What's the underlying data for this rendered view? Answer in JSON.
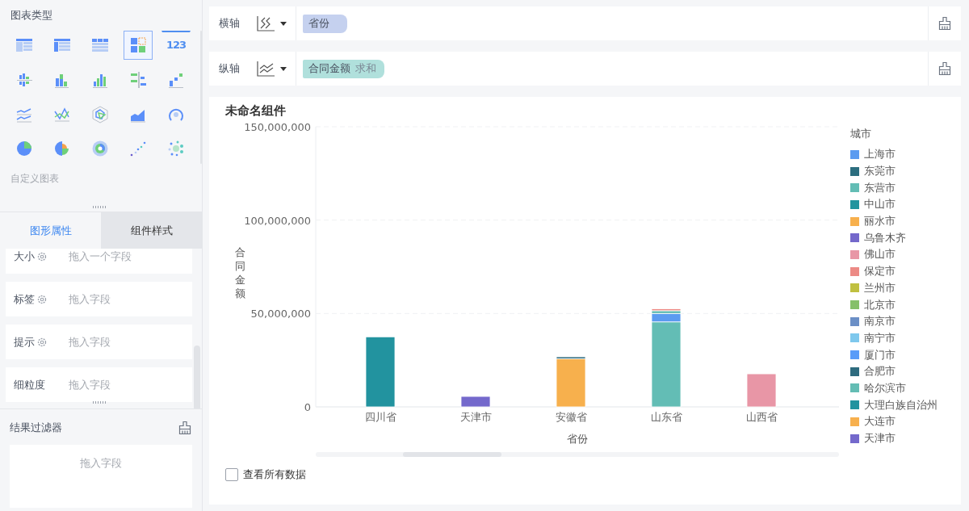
{
  "chart_types": {
    "title": "图表类型",
    "items": [
      {
        "kind": "table",
        "selected": false
      },
      {
        "kind": "cross-table",
        "selected": false
      },
      {
        "kind": "detail-table",
        "selected": false
      },
      {
        "kind": "matrix",
        "selected": true
      },
      {
        "kind": "number",
        "selected": false,
        "text": "123"
      },
      {
        "kind": "diverging-bar",
        "selected": false
      },
      {
        "kind": "stacked-bar",
        "selected": false
      },
      {
        "kind": "grouped-bar",
        "selected": false
      },
      {
        "kind": "horizontal-bar",
        "selected": false
      },
      {
        "kind": "waterfall",
        "selected": false
      },
      {
        "kind": "line",
        "selected": false
      },
      {
        "kind": "cross-line",
        "selected": false
      },
      {
        "kind": "radar",
        "selected": false
      },
      {
        "kind": "area",
        "selected": false
      },
      {
        "kind": "gauge",
        "selected": false
      },
      {
        "kind": "pie",
        "selected": false
      },
      {
        "kind": "rose",
        "selected": false
      },
      {
        "kind": "sunburst",
        "selected": false
      },
      {
        "kind": "scatter",
        "selected": false
      },
      {
        "kind": "bubble",
        "selected": false
      }
    ],
    "custom_label": "自定义图表"
  },
  "tabs": [
    {
      "label": "图形属性",
      "selected": true
    },
    {
      "label": "组件样式",
      "selected": false
    }
  ],
  "fields": [
    {
      "label": "大小",
      "settings": true,
      "placeholder": "拖入一个字段"
    },
    {
      "label": "标签",
      "settings": true,
      "placeholder": "拖入字段"
    },
    {
      "label": "提示",
      "settings": true,
      "placeholder": "拖入字段"
    },
    {
      "label": "细粒度",
      "settings": false,
      "placeholder": "拖入字段"
    }
  ],
  "result_filter": {
    "title": "结果过滤器",
    "placeholder": "拖入字段"
  },
  "shelves": [
    {
      "label": "横轴",
      "kind": "category",
      "pill": "省份",
      "color": "#c5d1ef"
    },
    {
      "label": "纵轴",
      "kind": "value",
      "pill": "合同金额",
      "pill_note": "求和",
      "color": "#b0e0dc"
    }
  ],
  "card": {
    "title": "未命名组件",
    "show_all": {
      "label": "查看所有数据",
      "checked": false
    },
    "chart_data": {
      "type": "bar",
      "stacked": true,
      "xlabel": "省份",
      "ylabel": "合同金额",
      "legend_title": "城市",
      "categories": [
        "四川省",
        "天津市",
        "安徽省",
        "山东省",
        "山西省"
      ],
      "ylim": [
        0,
        150000000
      ],
      "yticks": [
        {
          "value": 0,
          "label": "0"
        },
        {
          "value": 50000000,
          "label": "50,000,000"
        },
        {
          "value": 100000000,
          "label": "100,000,000"
        },
        {
          "value": 150000000,
          "label": "150,000,000"
        }
      ],
      "series": [
        {
          "name": "上海市",
          "color": "#5b9bf0",
          "values": [
            null,
            null,
            null,
            4500000,
            null
          ]
        },
        {
          "name": "东莞市",
          "color": "#2c6e7f",
          "values": [
            null,
            null,
            null,
            null,
            null
          ]
        },
        {
          "name": "东营市",
          "color": "#63bdb5",
          "values": [
            null,
            null,
            null,
            45500000,
            null
          ]
        },
        {
          "name": "中山市",
          "color": "#21949e",
          "values": [
            null,
            null,
            null,
            null,
            null
          ]
        },
        {
          "name": "丽水市",
          "color": "#f7b04d",
          "values": [
            null,
            null,
            25800000,
            null,
            null
          ]
        },
        {
          "name": "乌鲁木齐",
          "color": "#7468cb",
          "values": [
            null,
            null,
            null,
            null,
            null
          ]
        },
        {
          "name": "佛山市",
          "color": "#e896a6",
          "values": [
            null,
            null,
            null,
            null,
            17700000
          ]
        },
        {
          "name": "保定市",
          "color": "#ec8a85",
          "values": [
            null,
            null,
            null,
            1000000,
            null
          ]
        },
        {
          "name": "兰州市",
          "color": "#c0c040",
          "values": [
            null,
            null,
            null,
            null,
            null
          ]
        },
        {
          "name": "北京市",
          "color": "#86c06a",
          "values": [
            null,
            null,
            null,
            null,
            null
          ]
        },
        {
          "name": "南京市",
          "color": "#6b8fc6",
          "values": [
            null,
            null,
            null,
            null,
            null
          ]
        },
        {
          "name": "南宁市",
          "color": "#7ec8ed",
          "values": [
            null,
            null,
            null,
            null,
            null
          ]
        },
        {
          "name": "厦门市",
          "color": "#5a9cf8",
          "values": [
            null,
            null,
            null,
            null,
            null
          ]
        },
        {
          "name": "合肥市",
          "color": "#2e6b7e",
          "values": [
            null,
            null,
            1000000,
            null,
            null
          ]
        },
        {
          "name": "哈尔滨市",
          "color": "#64bdb4",
          "values": [
            null,
            null,
            null,
            1500000,
            null
          ]
        },
        {
          "name": "大理白族自治州",
          "color": "#22939f",
          "values": [
            37500000,
            null,
            null,
            null,
            null
          ]
        },
        {
          "name": "大连市",
          "color": "#f7b04e",
          "values": [
            null,
            null,
            null,
            null,
            null
          ]
        },
        {
          "name": "天津市",
          "color": "#7469cc",
          "values": [
            null,
            5600000,
            null,
            null,
            null
          ]
        }
      ]
    }
  }
}
